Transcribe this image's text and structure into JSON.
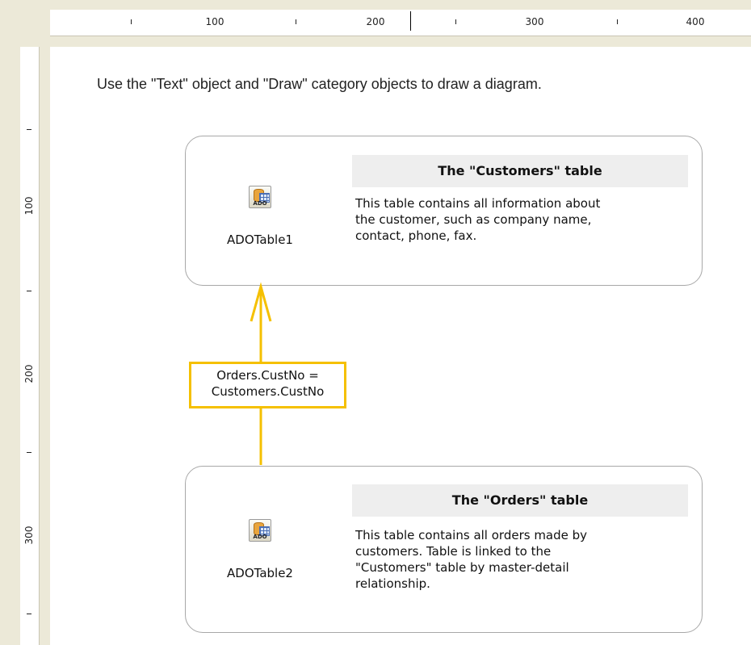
{
  "ruler": {
    "top_labels": [
      "100",
      "200",
      "300",
      "400"
    ],
    "left_labels": [
      "100",
      "200",
      "300"
    ]
  },
  "instruction": "Use the \"Text\" object and \"Draw\" category objects to draw a diagram.",
  "customers": {
    "component": "ADOTable1",
    "icon_text": "ADO",
    "title": "The \"Customers\" table",
    "description": "This table contains all information about\nthe customer, such as company name,\ncontact, phone, fax."
  },
  "orders": {
    "component": "ADOTable2",
    "icon_text": "ADO",
    "title": "The \"Orders\" table",
    "description": "This table contains all orders made by\ncustomers. Table is linked to the\n\"Customers\" table by master-detail\nrelationship."
  },
  "relation": {
    "label": "Orders.CustNo =\nCustomers.CustNo",
    "color": "#f5c000"
  },
  "colors": {
    "workspace": "#ece9d8",
    "title_bar": "#eeeeee",
    "connector": "#f5c000"
  }
}
